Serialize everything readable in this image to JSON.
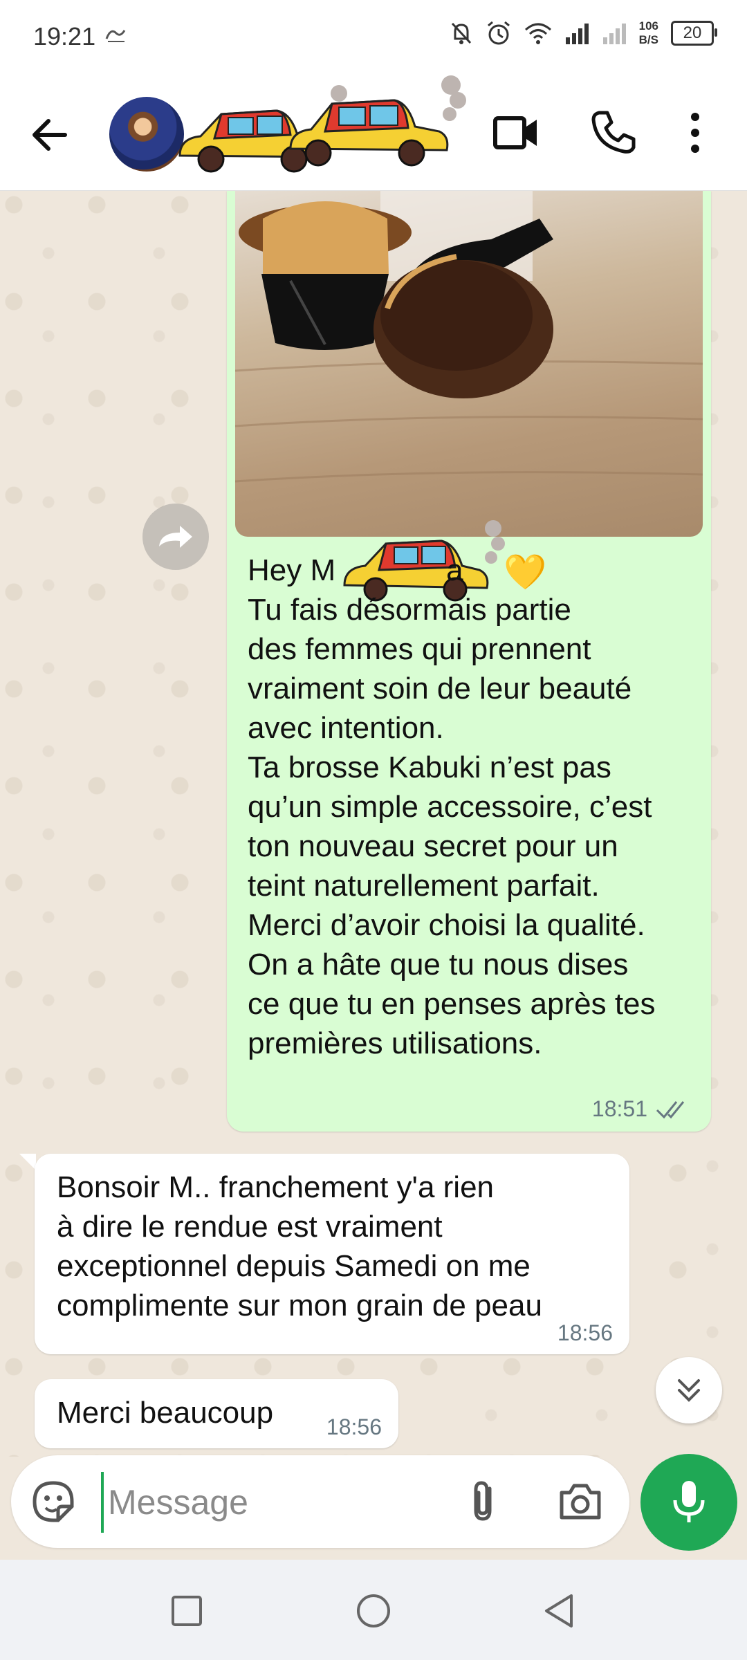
{
  "status_bar": {
    "time": "19:21",
    "speed_value": "106",
    "speed_unit": "B/S",
    "battery": "20"
  },
  "header": {
    "icons": [
      "back-arrow-icon",
      "avatar",
      "video-call-icon",
      "phone-icon",
      "more-vert-icon"
    ]
  },
  "messages": {
    "outgoing": {
      "greeting": "Hey M",
      "greeting_end": "a",
      "heart": "💛",
      "body": "Tu fais désormais partie\ndes femmes qui prennent\nvraiment soin de leur beauté\navec intention.\nTa brosse Kabuki n’est pas\nqu’un simple accessoire, c’est\nton nouveau secret pour un\nteint naturellement parfait.\nMerci d’avoir choisi la qualité.\nOn a hâte que tu nous dises\nce que tu en penses après tes\npremières utilisations.",
      "time": "18:51"
    },
    "incoming_1": {
      "text": "Bonsoir M.. franchement y'a rien\nà dire le rendue est vraiment\nexceptionnel depuis Samedi on me\ncomplimente sur mon grain de peau",
      "time": "18:56"
    },
    "incoming_2": {
      "text": "Merci beaucoup",
      "time": "18:56"
    }
  },
  "composer": {
    "placeholder": "Message"
  },
  "colors": {
    "accent": "#1fa855",
    "outgoing_bubble": "#d9fdd3",
    "chat_bg": "#efe7dc"
  }
}
